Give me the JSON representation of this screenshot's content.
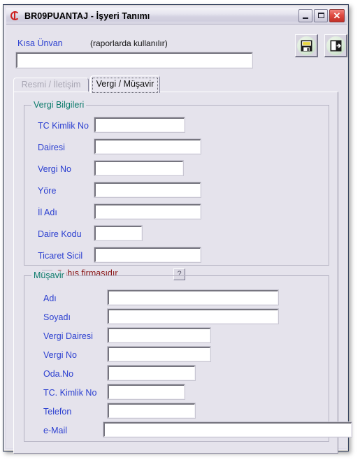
{
  "window": {
    "title": "BR09PUANTAJ - İşyeri Tanımı",
    "app_icon": "app-logo-icon",
    "controls": {
      "minimize": "minimize-icon",
      "maximize": "maximize-icon",
      "close": "close-icon",
      "close_glyph": "✕"
    }
  },
  "header": {
    "short_title_label": "Kısa Ünvan",
    "short_title_hint": "(raporlarda kullanılır)",
    "short_title_value": "",
    "short_title_placeholder": ""
  },
  "toolbar": {
    "save_icon": "save-disk-icon",
    "exit_icon": "exit-door-icon"
  },
  "tabs": [
    {
      "label": "Resmi / İletişim",
      "active": false
    },
    {
      "label": "Vergi / Müşavir",
      "active": true
    }
  ],
  "groups": [
    {
      "title": "Vergi Bilgileri",
      "fields": [
        {
          "label": "TC Kimlik No",
          "value": ""
        },
        {
          "label": "Dairesi",
          "value": ""
        },
        {
          "label": "Vergi No",
          "value": ""
        },
        {
          "label": "Yöre",
          "value": ""
        },
        {
          "label": "İl Adı",
          "value": ""
        },
        {
          "label": "Daire Kodu",
          "value": ""
        },
        {
          "label": "Ticaret Sicil",
          "value": ""
        }
      ],
      "checkbox": {
        "label": "Şahıs firmasıdır",
        "checked": false
      },
      "help_button": "?"
    },
    {
      "title": "Müşavir",
      "fields": [
        {
          "label": "Adı",
          "value": ""
        },
        {
          "label": "Soyadı",
          "value": ""
        },
        {
          "label": "Vergi Dairesi",
          "value": ""
        },
        {
          "label": "Vergi No",
          "value": ""
        },
        {
          "label": "Oda.No",
          "value": ""
        },
        {
          "label": "TC. Kimlik No",
          "value": ""
        },
        {
          "label": "Telefon",
          "value": ""
        },
        {
          "label": "e-Mail",
          "value": ""
        }
      ]
    }
  ],
  "colors": {
    "label_blue": "#2b3fd0",
    "group_green": "#0a7a6a",
    "checkbox_red": "#8a1616",
    "face": "#e5e3ec",
    "close_red": "#e04b42"
  }
}
